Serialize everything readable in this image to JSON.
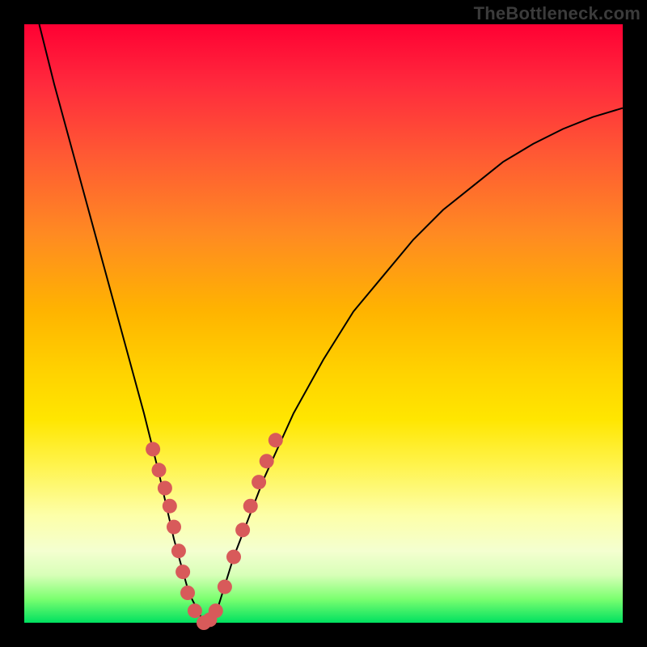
{
  "watermark": "TheBottleneck.com",
  "chart_data": {
    "type": "line",
    "title": "",
    "xlabel": "",
    "ylabel": "",
    "xlim": [
      0,
      1
    ],
    "ylim": [
      0,
      1
    ],
    "grid": false,
    "legend": false,
    "series": [
      {
        "name": "bottleneck-curve",
        "x": [
          0.025,
          0.05,
          0.08,
          0.11,
          0.14,
          0.17,
          0.2,
          0.225,
          0.25,
          0.275,
          0.3,
          0.325,
          0.35,
          0.4,
          0.45,
          0.5,
          0.55,
          0.6,
          0.65,
          0.7,
          0.75,
          0.8,
          0.85,
          0.9,
          0.95,
          1.0
        ],
        "y": [
          1.0,
          0.9,
          0.79,
          0.68,
          0.57,
          0.46,
          0.35,
          0.25,
          0.14,
          0.05,
          0.0,
          0.03,
          0.11,
          0.24,
          0.35,
          0.44,
          0.52,
          0.58,
          0.64,
          0.69,
          0.73,
          0.77,
          0.8,
          0.825,
          0.845,
          0.86
        ]
      }
    ],
    "sample_points": {
      "name": "samples",
      "x": [
        0.215,
        0.225,
        0.235,
        0.243,
        0.25,
        0.258,
        0.265,
        0.273,
        0.285,
        0.3,
        0.31,
        0.32,
        0.335,
        0.35,
        0.365,
        0.378,
        0.392,
        0.405,
        0.42
      ],
      "y": [
        0.29,
        0.255,
        0.225,
        0.195,
        0.16,
        0.12,
        0.085,
        0.05,
        0.02,
        0.0,
        0.005,
        0.02,
        0.06,
        0.11,
        0.155,
        0.195,
        0.235,
        0.27,
        0.305
      ]
    },
    "background_gradient": {
      "top": "#ff0033",
      "mid_upper": "#ffb400",
      "mid_lower": "#fff450",
      "bottom": "#00e060"
    }
  }
}
